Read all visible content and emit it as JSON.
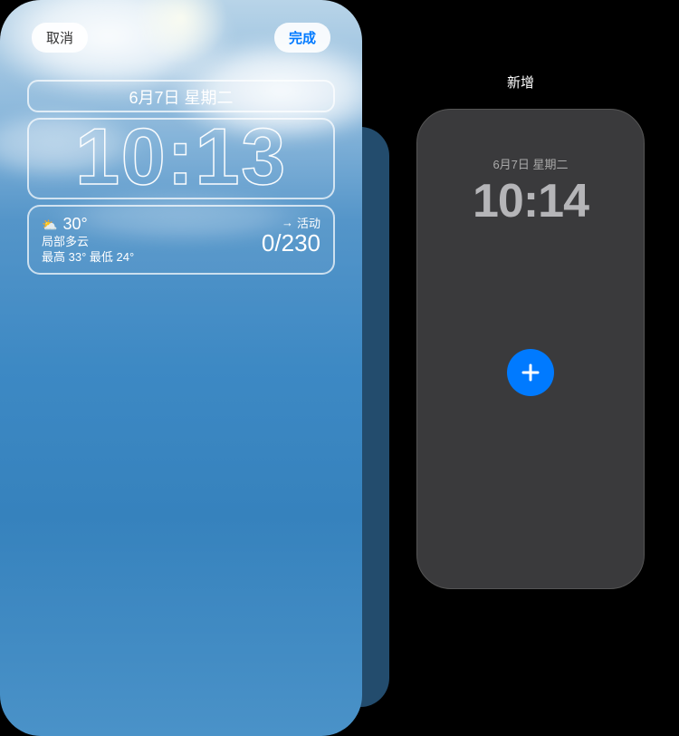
{
  "buttons": {
    "cancel": "取消",
    "done": "完成"
  },
  "lockscreen": {
    "date": "6月7日 星期二",
    "time": "10:13",
    "weather": {
      "temp": "30°",
      "condition": "局部多云",
      "range": "最高 33° 最低 24°"
    },
    "activity": {
      "label": "活动",
      "value": "0/230"
    }
  },
  "preview": {
    "title": "新增",
    "date": "6月7日 星期二",
    "time": "10:14"
  }
}
